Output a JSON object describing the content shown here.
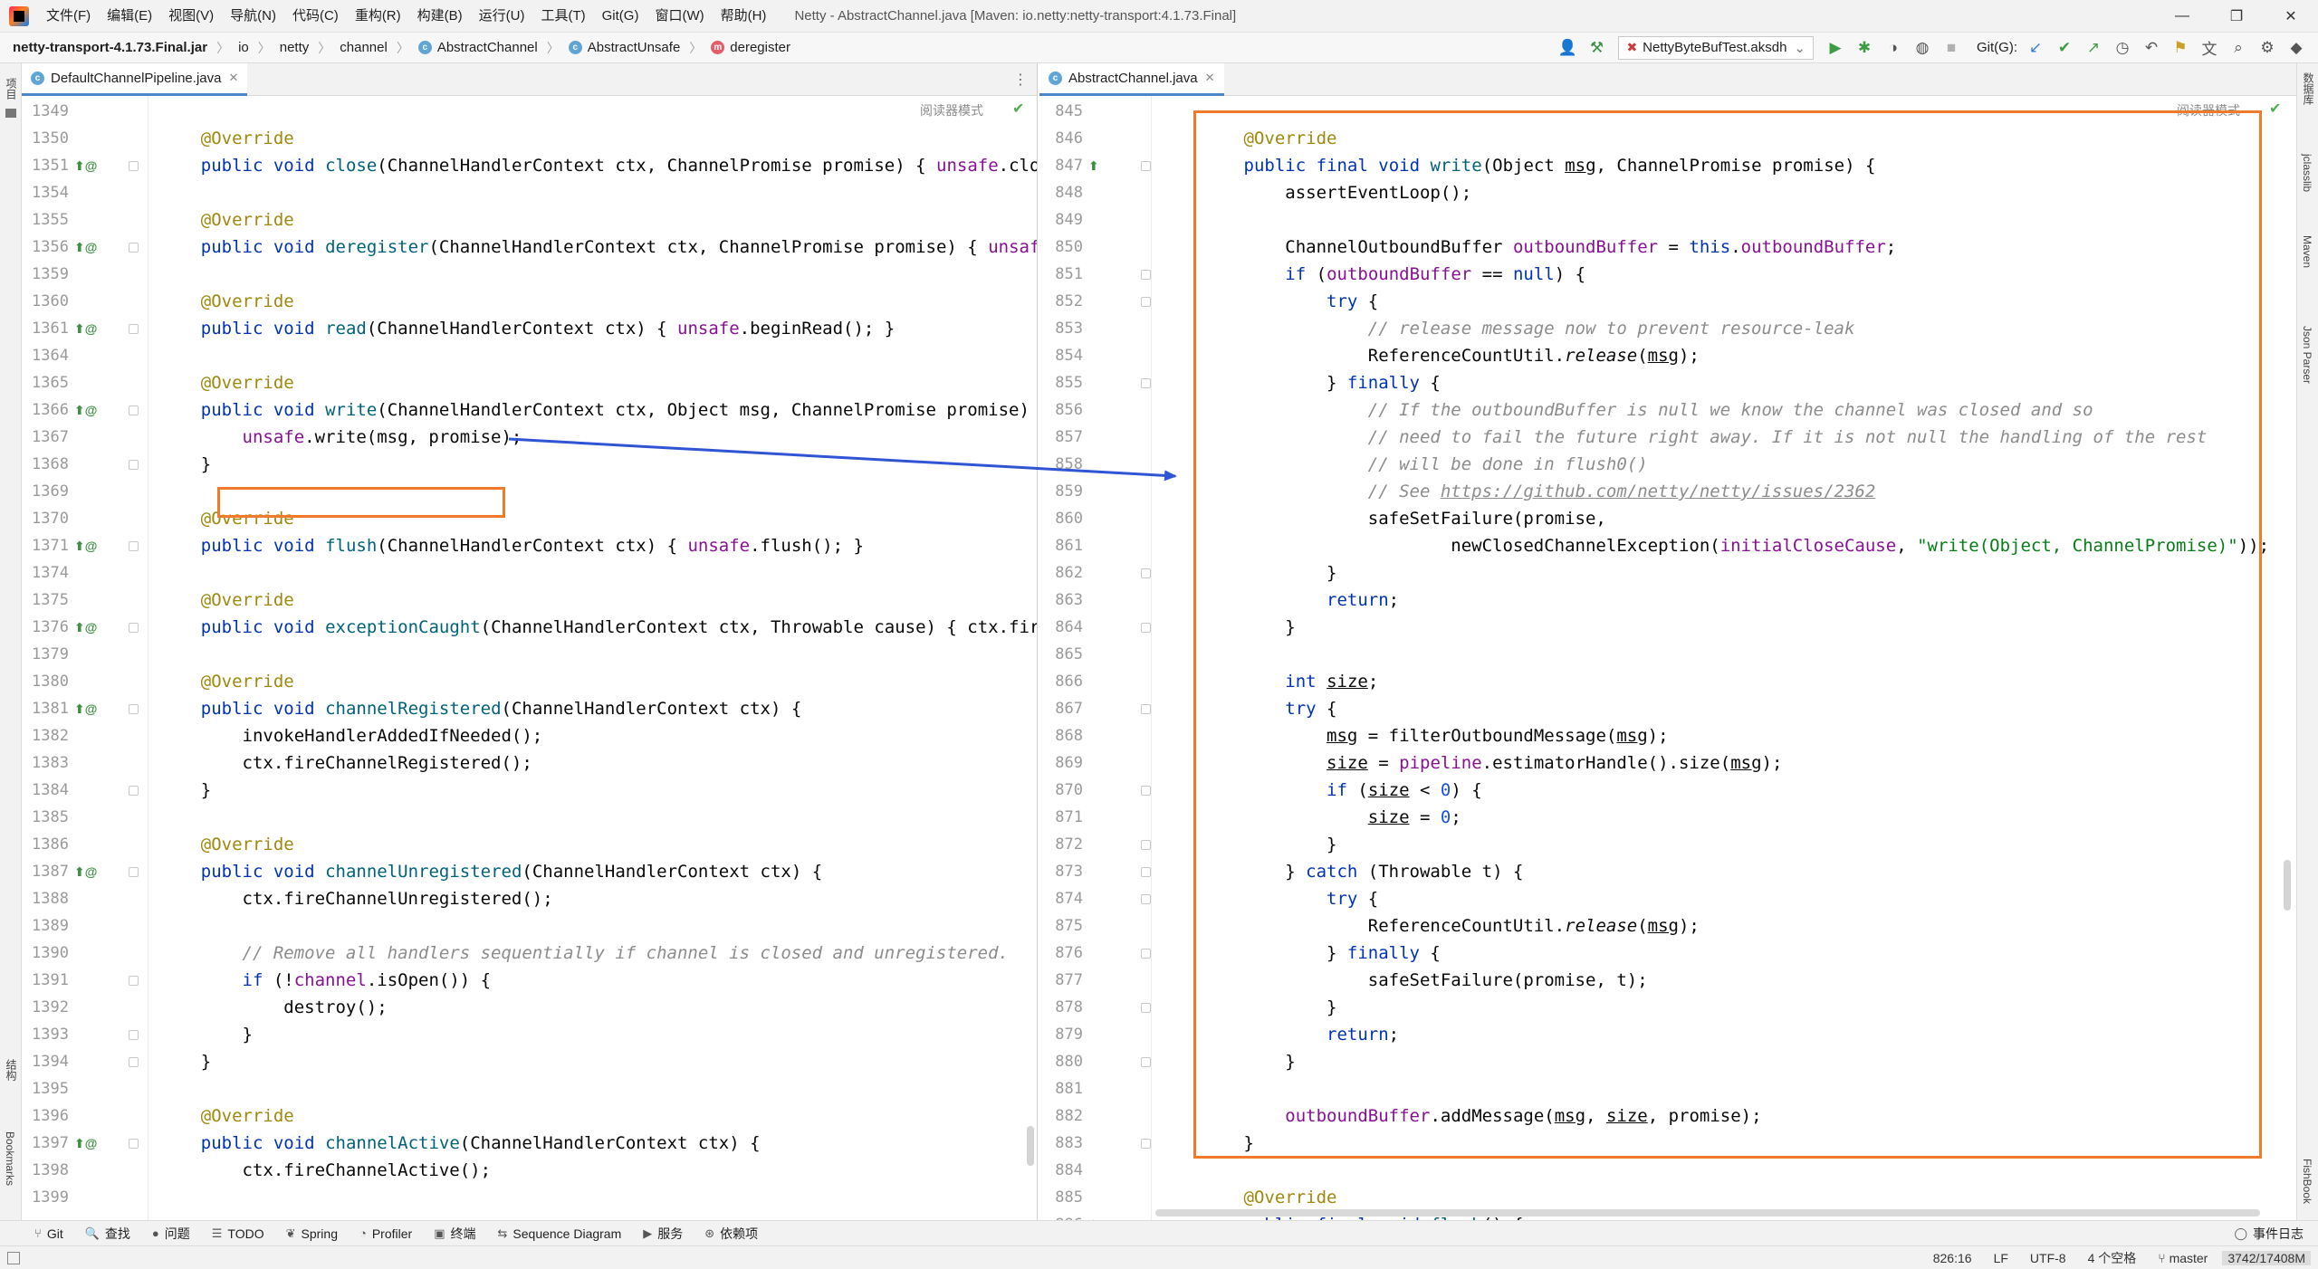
{
  "menubar": {
    "items": [
      "文件(F)",
      "编辑(E)",
      "视图(V)",
      "导航(N)",
      "代码(C)",
      "重构(R)",
      "构建(B)",
      "运行(U)",
      "工具(T)",
      "Git(G)",
      "窗口(W)",
      "帮助(H)"
    ],
    "window_title": "Netty - AbstractChannel.java [Maven: io.netty:netty-transport:4.1.73.Final]"
  },
  "navbar": {
    "crumbs": [
      "netty-transport-4.1.73.Final.jar",
      "io",
      "netty",
      "channel",
      "AbstractChannel",
      "AbstractUnsafe",
      "deregister"
    ],
    "run_config": "NettyByteBufTest.aksdh",
    "git_label": "Git(G):"
  },
  "side_labels": {
    "left_top": "项目",
    "left_structure": "结构",
    "left_bookmarks": "Bookmarks",
    "right_db": "数据库",
    "right_jclasslib": "jclasslib",
    "right_maven": "Maven",
    "right_json": "Json Parser",
    "right_fishbook": "FishBook"
  },
  "left_editor": {
    "tab": "DefaultChannelPipeline.java",
    "reader_mode": "阅读器模式",
    "lines": [
      {
        "n": "1349",
        "c": ""
      },
      {
        "n": "1350",
        "c": "    @Override"
      },
      {
        "n": "1351",
        "c": "    public void close(ChannelHandlerContext ctx, ChannelPromise promise) { unsafe.close(promise); }"
      },
      {
        "n": "1354",
        "c": ""
      },
      {
        "n": "1355",
        "c": "    @Override"
      },
      {
        "n": "1356",
        "c": "    public void deregister(ChannelHandlerContext ctx, ChannelPromise promise) { unsafe.deregister(promise); }"
      },
      {
        "n": "1359",
        "c": ""
      },
      {
        "n": "1360",
        "c": "    @Override"
      },
      {
        "n": "1361",
        "c": "    public void read(ChannelHandlerContext ctx) { unsafe.beginRead(); }"
      },
      {
        "n": "1364",
        "c": ""
      },
      {
        "n": "1365",
        "c": "    @Override"
      },
      {
        "n": "1366",
        "c": "    public void write(ChannelHandlerContext ctx, Object msg, ChannelPromise promise) {"
      },
      {
        "n": "1367",
        "c": "        unsafe.write(msg, promise);"
      },
      {
        "n": "1368",
        "c": "    }"
      },
      {
        "n": "1369",
        "c": ""
      },
      {
        "n": "1370",
        "c": "    @Override"
      },
      {
        "n": "1371",
        "c": "    public void flush(ChannelHandlerContext ctx) { unsafe.flush(); }"
      },
      {
        "n": "1374",
        "c": ""
      },
      {
        "n": "1375",
        "c": "    @Override"
      },
      {
        "n": "1376",
        "c": "    public void exceptionCaught(ChannelHandlerContext ctx, Throwable cause) { ctx.fireExceptionCaught(cause); }"
      },
      {
        "n": "1379",
        "c": ""
      },
      {
        "n": "1380",
        "c": "    @Override"
      },
      {
        "n": "1381",
        "c": "    public void channelRegistered(ChannelHandlerContext ctx) {"
      },
      {
        "n": "1382",
        "c": "        invokeHandlerAddedIfNeeded();"
      },
      {
        "n": "1383",
        "c": "        ctx.fireChannelRegistered();"
      },
      {
        "n": "1384",
        "c": "    }"
      },
      {
        "n": "1385",
        "c": ""
      },
      {
        "n": "1386",
        "c": "    @Override"
      },
      {
        "n": "1387",
        "c": "    public void channelUnregistered(ChannelHandlerContext ctx) {"
      },
      {
        "n": "1388",
        "c": "        ctx.fireChannelUnregistered();"
      },
      {
        "n": "1389",
        "c": ""
      },
      {
        "n": "1390",
        "c": "        // Remove all handlers sequentially if channel is closed and unregistered."
      },
      {
        "n": "1391",
        "c": "        if (!channel.isOpen()) {"
      },
      {
        "n": "1392",
        "c": "            destroy();"
      },
      {
        "n": "1393",
        "c": "        }"
      },
      {
        "n": "1394",
        "c": "    }"
      },
      {
        "n": "1395",
        "c": ""
      },
      {
        "n": "1396",
        "c": "    @Override"
      },
      {
        "n": "1397",
        "c": "    public void channelActive(ChannelHandlerContext ctx) {"
      },
      {
        "n": "1398",
        "c": "        ctx.fireChannelActive();"
      },
      {
        "n": "1399",
        "c": ""
      }
    ]
  },
  "right_editor": {
    "tab": "AbstractChannel.java",
    "reader_mode": "阅读器模式",
    "lines": [
      {
        "n": "845",
        "c": ""
      },
      {
        "n": "846",
        "c": "        @Override"
      },
      {
        "n": "847",
        "c": "        public final void write(Object msg, ChannelPromise promise) {"
      },
      {
        "n": "848",
        "c": "            assertEventLoop();"
      },
      {
        "n": "849",
        "c": ""
      },
      {
        "n": "850",
        "c": "            ChannelOutboundBuffer outboundBuffer = this.outboundBuffer;"
      },
      {
        "n": "851",
        "c": "            if (outboundBuffer == null) {"
      },
      {
        "n": "852",
        "c": "                try {"
      },
      {
        "n": "853",
        "c": "                    // release message now to prevent resource-leak"
      },
      {
        "n": "854",
        "c": "                    ReferenceCountUtil.release(msg);"
      },
      {
        "n": "855",
        "c": "                } finally {"
      },
      {
        "n": "856",
        "c": "                    // If the outboundBuffer is null we know the channel was closed and so"
      },
      {
        "n": "857",
        "c": "                    // need to fail the future right away. If it is not null the handling of the rest"
      },
      {
        "n": "858",
        "c": "                    // will be done in flush0()"
      },
      {
        "n": "859",
        "c": "                    // See https://github.com/netty/netty/issues/2362"
      },
      {
        "n": "860",
        "c": "                    safeSetFailure(promise,"
      },
      {
        "n": "861",
        "c": "                            newClosedChannelException(initialCloseCause, \"write(Object, ChannelPromise)\"));"
      },
      {
        "n": "862",
        "c": "                }"
      },
      {
        "n": "863",
        "c": "                return;"
      },
      {
        "n": "864",
        "c": "            }"
      },
      {
        "n": "865",
        "c": ""
      },
      {
        "n": "866",
        "c": "            int size;"
      },
      {
        "n": "867",
        "c": "            try {"
      },
      {
        "n": "868",
        "c": "                msg = filterOutboundMessage(msg);"
      },
      {
        "n": "869",
        "c": "                size = pipeline.estimatorHandle().size(msg);"
      },
      {
        "n": "870",
        "c": "                if (size < 0) {"
      },
      {
        "n": "871",
        "c": "                    size = 0;"
      },
      {
        "n": "872",
        "c": "                }"
      },
      {
        "n": "873",
        "c": "            } catch (Throwable t) {"
      },
      {
        "n": "874",
        "c": "                try {"
      },
      {
        "n": "875",
        "c": "                    ReferenceCountUtil.release(msg);"
      },
      {
        "n": "876",
        "c": "                } finally {"
      },
      {
        "n": "877",
        "c": "                    safeSetFailure(promise, t);"
      },
      {
        "n": "878",
        "c": "                }"
      },
      {
        "n": "879",
        "c": "                return;"
      },
      {
        "n": "880",
        "c": "            }"
      },
      {
        "n": "881",
        "c": ""
      },
      {
        "n": "882",
        "c": "            outboundBuffer.addMessage(msg, size, promise);"
      },
      {
        "n": "883",
        "c": "        }"
      },
      {
        "n": "884",
        "c": ""
      },
      {
        "n": "885",
        "c": "        @Override"
      },
      {
        "n": "886",
        "c": "        public final void flush() {"
      }
    ]
  },
  "bottom_tools": [
    {
      "icon": "git-icon",
      "glyph": "⑂",
      "label": "Git"
    },
    {
      "icon": "search-icon",
      "glyph": "🔍",
      "label": "查找"
    },
    {
      "icon": "problems-icon",
      "glyph": "●",
      "label": "问题"
    },
    {
      "icon": "todo-icon",
      "glyph": "☰",
      "label": "TODO"
    },
    {
      "icon": "spring-icon",
      "glyph": "❦",
      "label": "Spring"
    },
    {
      "icon": "profiler-icon",
      "glyph": "◔",
      "label": "Profiler"
    },
    {
      "icon": "terminal-icon",
      "glyph": "▣",
      "label": "终端"
    },
    {
      "icon": "sequence-diagram-icon",
      "glyph": "⇆",
      "label": "Sequence Diagram"
    },
    {
      "icon": "services-icon",
      "glyph": "▶",
      "label": "服务"
    },
    {
      "icon": "dependencies-icon",
      "glyph": "⊛",
      "label": "依赖项"
    }
  ],
  "event_log": "事件日志",
  "statusbar": {
    "position": "826:16",
    "line_sep": "LF",
    "encoding": "UTF-8",
    "indent": "4 个空格",
    "branch": "master",
    "memory": "3742/17408M"
  }
}
